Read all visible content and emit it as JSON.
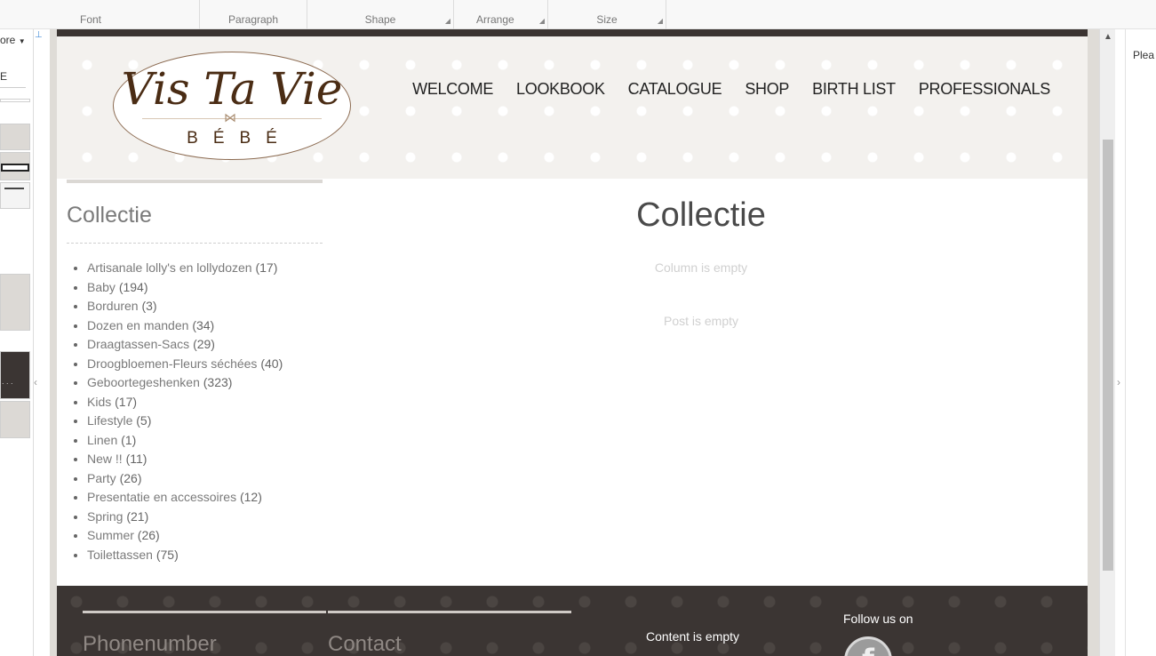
{
  "ribbon": {
    "groups": [
      "Font",
      "Paragraph",
      "Shape",
      "Arrange",
      "Size"
    ]
  },
  "left_panel": {
    "more_label": "ore",
    "field_value": "E"
  },
  "right_panel": {
    "hint": "Plea"
  },
  "site": {
    "logo": {
      "line1": "Vis Ta Vie",
      "line2": "BÉBÉ"
    },
    "nav": [
      "WELCOME",
      "LOOKBOOK",
      "CATALOGUE",
      "SHOP",
      "BIRTH LIST",
      "PROFESSIONALS"
    ],
    "sidebar": {
      "title": "Collectie",
      "categories": [
        {
          "name": "Artisanale lolly's en lollydozen",
          "count": "(17)"
        },
        {
          "name": "Baby",
          "count": "(194)"
        },
        {
          "name": "Borduren",
          "count": "(3)"
        },
        {
          "name": "Dozen en manden",
          "count": "(34)"
        },
        {
          "name": "Draagtassen-Sacs",
          "count": "(29)"
        },
        {
          "name": "Droogbloemen-Fleurs séchées",
          "count": "(40)"
        },
        {
          "name": "Geboortegeshenken",
          "count": "(323)"
        },
        {
          "name": "Kids",
          "count": "(17)"
        },
        {
          "name": "Lifestyle",
          "count": "(5)"
        },
        {
          "name": "Linen",
          "count": "(1)"
        },
        {
          "name": "New !!",
          "count": "(11)"
        },
        {
          "name": "Party",
          "count": "(26)"
        },
        {
          "name": "Presentatie en accessoires",
          "count": "(12)"
        },
        {
          "name": "Spring",
          "count": "(21)"
        },
        {
          "name": "Summer",
          "count": "(26)"
        },
        {
          "name": "Toilettassen",
          "count": "(75)"
        }
      ]
    },
    "main": {
      "title": "Collectie",
      "column_empty": "Column is empty",
      "post_empty": "Post is empty"
    },
    "footer": {
      "phone_heading": "Phonenumber",
      "contact_heading": "Contact",
      "content_empty": "Content is empty",
      "follow_label": "Follow us on",
      "facebook_glyph": "f"
    }
  }
}
